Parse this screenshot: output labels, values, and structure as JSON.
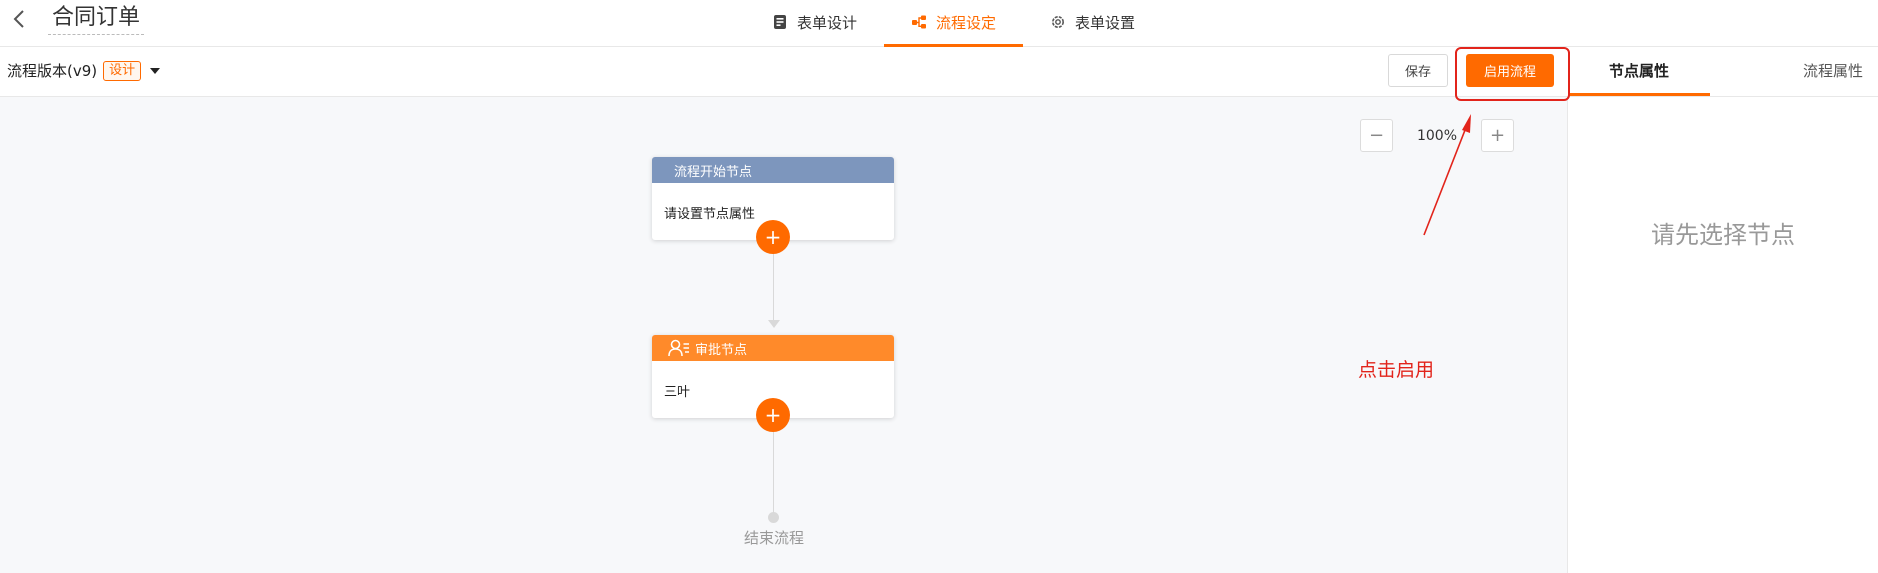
{
  "header": {
    "title": "合同订单",
    "tabs": [
      {
        "label": "表单设计",
        "icon": "form-icon",
        "active": false
      },
      {
        "label": "流程设定",
        "icon": "flow-icon",
        "active": true
      },
      {
        "label": "表单设置",
        "icon": "gear-icon",
        "active": false
      }
    ]
  },
  "toolbar": {
    "version_label": "流程版本(v9)",
    "version_badge": "设计",
    "save_label": "保存",
    "enable_label": "启用流程"
  },
  "right_panel": {
    "tabs": [
      {
        "label": "节点属性",
        "active": true
      },
      {
        "label": "流程属性",
        "active": false
      }
    ],
    "empty_tip": "请先选择节点"
  },
  "canvas": {
    "zoom": {
      "minus": "−",
      "value": "100%",
      "plus": "+"
    },
    "start_node": {
      "title": "流程开始节点",
      "body": "请设置节点属性"
    },
    "approve_node": {
      "title": "审批节点",
      "body": "三叶",
      "icon": "user-approval-icon"
    },
    "add_symbol": "+",
    "end_label": "结束流程"
  },
  "annotation": {
    "text": "点击启用",
    "color": "#e2241b"
  },
  "colors": {
    "accent": "#ff6a00",
    "start_header": "#7d96bd",
    "approve_header": "#ff8a2a"
  }
}
